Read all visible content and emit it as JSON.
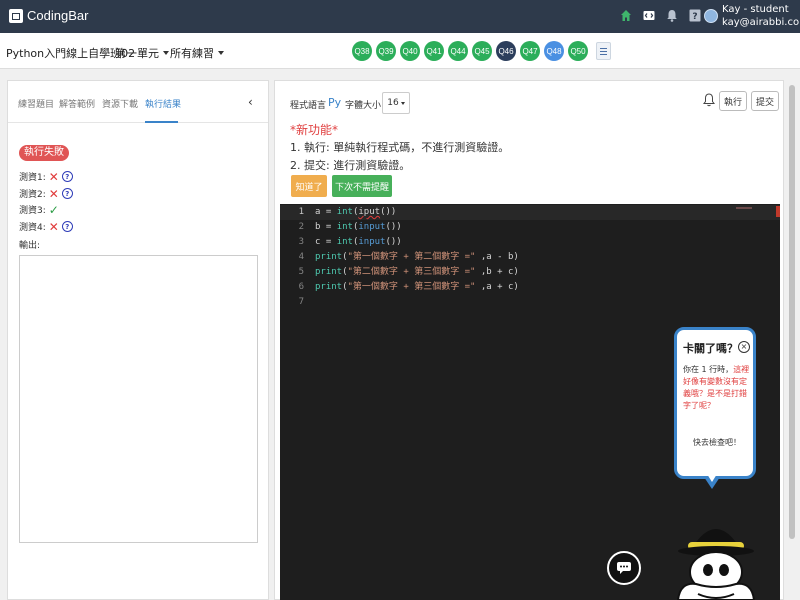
{
  "topbar": {
    "brand": "CodingBar",
    "user_name": "Kay - student",
    "user_email": "kay@airabbi.com",
    "icons": [
      "home-icon",
      "code-icon",
      "bell-icon",
      "help-icon",
      "avatar"
    ]
  },
  "subbar": {
    "course_title": "Python入門線上自學班02",
    "unit_dropdown": "第一單元",
    "practice_dropdown": "所有練習",
    "questions": [
      {
        "label": "Q38",
        "state": "done"
      },
      {
        "label": "Q39",
        "state": "done"
      },
      {
        "label": "Q40",
        "state": "done"
      },
      {
        "label": "Q41",
        "state": "done"
      },
      {
        "label": "Q44",
        "state": "done"
      },
      {
        "label": "Q45",
        "state": "done"
      },
      {
        "label": "Q46",
        "state": "current"
      },
      {
        "label": "Q47",
        "state": "done"
      },
      {
        "label": "Q48",
        "state": "selected"
      },
      {
        "label": "Q50",
        "state": "done"
      }
    ]
  },
  "left_panel": {
    "tabs": [
      "練習題目",
      "解答範例",
      "資源下載",
      "執行結果"
    ],
    "active_tab": 3,
    "status_badge": "執行失敗",
    "tests": [
      {
        "label": "測資1:",
        "result": "fail"
      },
      {
        "label": "測資2:",
        "result": "fail"
      },
      {
        "label": "測資3:",
        "result": "pass"
      },
      {
        "label": "測資4:",
        "result": "fail"
      }
    ],
    "output_label": "輸出:",
    "output_value": ""
  },
  "right_panel": {
    "language_label": "程式語言",
    "language_value": "Py",
    "font_size_label": "字體大小",
    "font_size_value": "16",
    "run_button": "執行",
    "submit_button": "提交",
    "new_feature_title": "*新功能*",
    "feature_line1": "1. 執行: 單純執行程式碼，不進行測資驗證。",
    "feature_line2": "2. 提交: 進行測資驗證。",
    "got_it_button": "知道了",
    "no_remind_button": "下次不需提醒"
  },
  "editor": {
    "lines": [
      {
        "num": "1",
        "code": "a = int(iput())"
      },
      {
        "num": "2",
        "code": "b = int(input())"
      },
      {
        "num": "3",
        "code": "c = int(input())"
      },
      {
        "num": "4",
        "code": "print(\"第一個數字 + 第二個數字 =\" ,a - b)"
      },
      {
        "num": "5",
        "code": "print(\"第二個數字 + 第三個數字 =\" ,b + c)"
      },
      {
        "num": "6",
        "code": "print(\"第一個數字 + 第三個數字 =\" ,a + c)"
      },
      {
        "num": "7",
        "code": ""
      }
    ]
  },
  "hint_bubble": {
    "title": "卡關了嗎？",
    "close": "×",
    "text_prefix": "你在 1 行時，",
    "text_highlight": "這裡好像有變數沒有定義哦？是不是打錯字了呢？",
    "check_label": "快去檢查吧！"
  },
  "colors": {
    "topbar": "#2e3a4b",
    "done": "#2cae5a",
    "current": "#2c3e5c",
    "selected": "#4a90e2",
    "fail": "#e05555",
    "accent": "#3a83c9"
  }
}
